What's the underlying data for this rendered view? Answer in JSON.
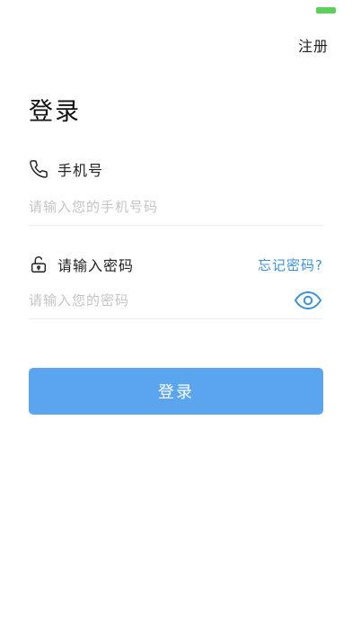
{
  "header": {
    "register_label": "注册"
  },
  "page": {
    "title": "登录"
  },
  "phone": {
    "label": "手机号",
    "placeholder": "请输入您的手机号码",
    "value": "",
    "icon": "phone-icon"
  },
  "password": {
    "label": "请输入密码",
    "forgot_label": "忘记密码?",
    "placeholder": "请输入您的密码",
    "value": "",
    "icon": "unlock-icon",
    "toggle_icon": "eye-icon"
  },
  "actions": {
    "login_label": "登录"
  },
  "colors": {
    "accent": "#3d92d8",
    "button": "#5aa5ee",
    "battery": "#5ad25a"
  }
}
